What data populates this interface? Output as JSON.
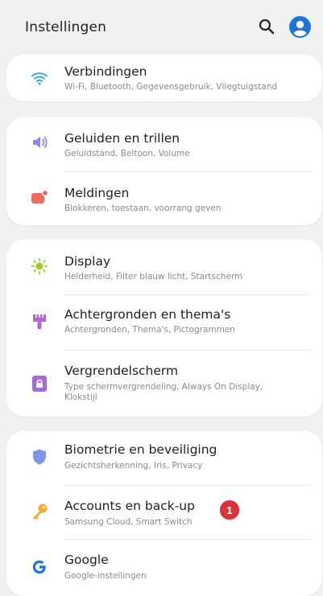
{
  "header": {
    "title": "Instellingen"
  },
  "groups": [
    {
      "items": [
        {
          "title": "Verbindingen",
          "subtitle": "Wi-Fi, Bluetooth, Gegevensgebruik, Vliegtuigstand",
          "icon": "wifi-icon"
        }
      ]
    },
    {
      "items": [
        {
          "title": "Geluiden en trillen",
          "subtitle": "Geluidstand, Beltoon, Volume",
          "icon": "speaker-icon"
        },
        {
          "title": "Meldingen",
          "subtitle": "Blokkeren, toestaan, voorrang geven",
          "icon": "notification-icon"
        }
      ]
    },
    {
      "items": [
        {
          "title": "Display",
          "subtitle": "Helderheid, Filter blauw licht, Startscherm",
          "icon": "sun-icon"
        },
        {
          "title": "Achtergronden en thema's",
          "subtitle": "Achtergronden, Thema's, Pictogrammen",
          "icon": "paintbrush-icon"
        },
        {
          "title": "Vergrendelscherm",
          "subtitle": "Type schermvergrendeling, Always On Display, Klokstijl",
          "icon": "lock-icon"
        }
      ]
    },
    {
      "items": [
        {
          "title": "Biometrie en beveiliging",
          "subtitle": "Gezichtsherkenning, Iris, Privacy",
          "icon": "shield-icon"
        },
        {
          "title": "Accounts en back-up",
          "subtitle": "Samsung Cloud, Smart Switch",
          "icon": "key-icon"
        },
        {
          "title": "Google",
          "subtitle": "Google-instellingen",
          "icon": "google-icon"
        }
      ]
    }
  ],
  "badge": {
    "label": "1",
    "color": "#d8333a"
  },
  "colors": {
    "background": "#f1f1f1",
    "card": "#ffffff",
    "wifi": "#3fa9e8",
    "speaker": "#8c84ee",
    "notification": "#ef6b60",
    "display": "#9ccc34",
    "theme": "#b264d3",
    "lock": "#a36bd3",
    "shield": "#7e95e8",
    "key": "#f4a935",
    "avatar": "#1f73d8"
  }
}
